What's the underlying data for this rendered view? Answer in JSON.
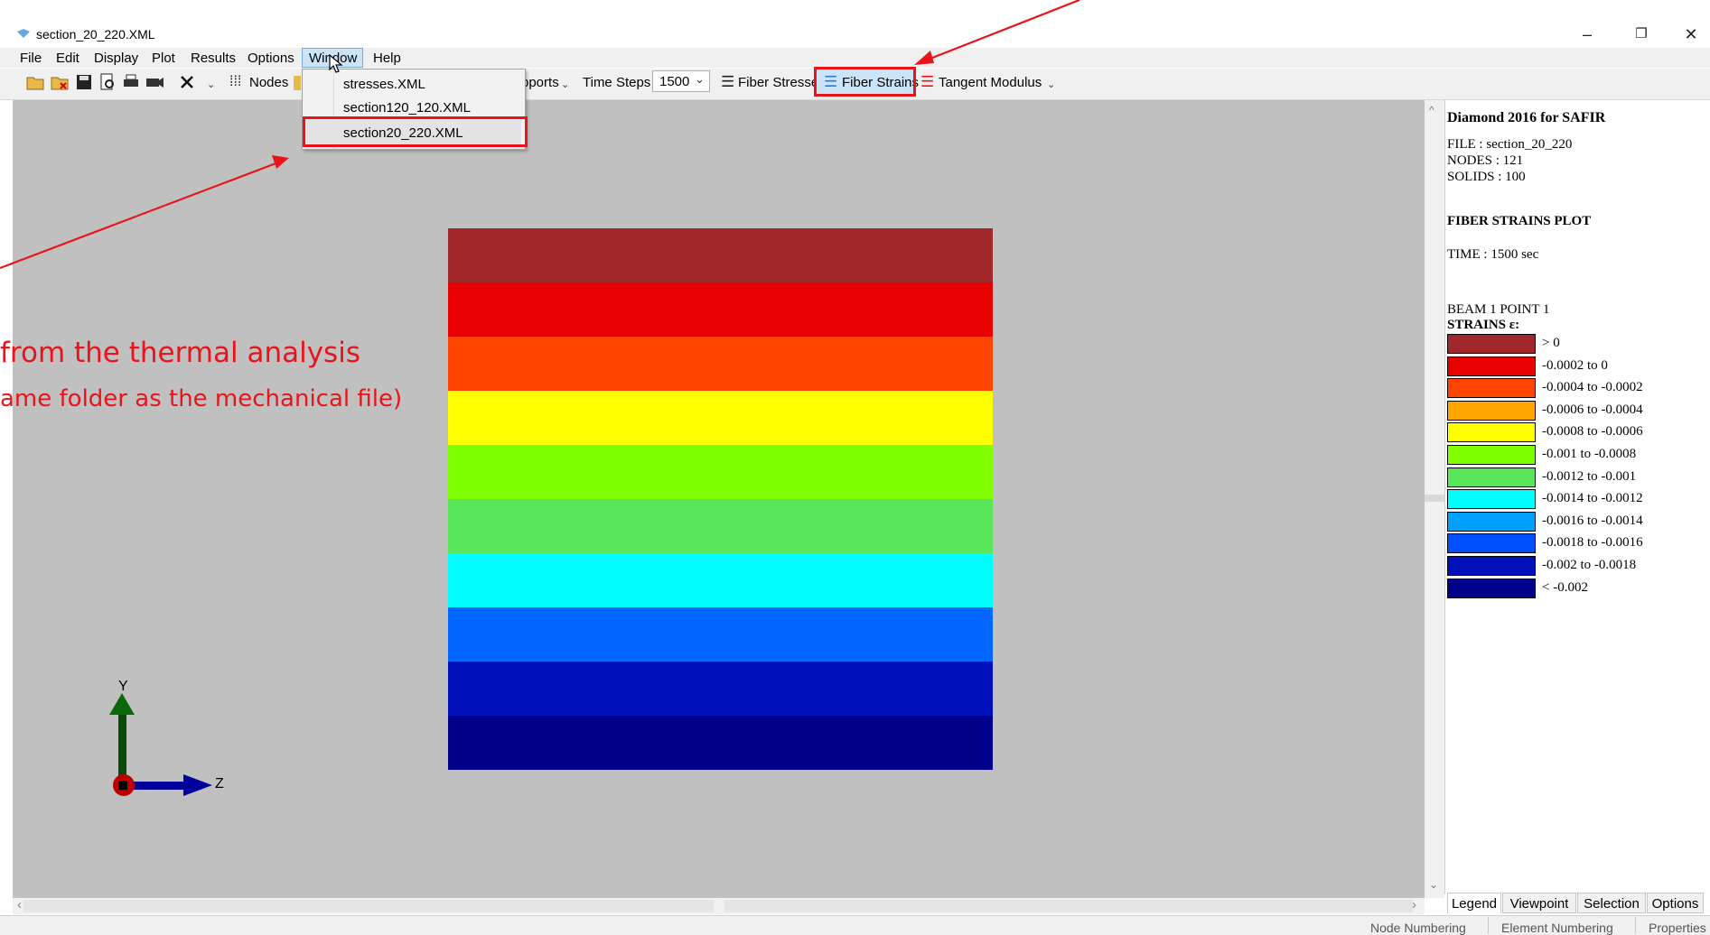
{
  "window": {
    "title": "section_20_220.XML",
    "minimize": "–",
    "restore": "❐",
    "close": "✕"
  },
  "menubar": [
    "File",
    "Edit",
    "Display",
    "Plot",
    "Results",
    "Options",
    "Window",
    "Help"
  ],
  "toolbar": {
    "nodes_label": "Nodes",
    "supports_partial": "pports",
    "time_steps_label": "Time Steps",
    "time_steps_value": "1500",
    "fiber_stresses": "Fiber Stresses",
    "fiber_strains": "Fiber Strains",
    "tangent_modulus": "Tangent Modulus"
  },
  "window_menu": {
    "items": [
      "stresses.XML",
      "section120_120.XML",
      "section20_220.XML"
    ],
    "highlighted_item": "section20_220.XML"
  },
  "annotation": {
    "line1": "from the thermal analysis",
    "line2": "ame folder as the mechanical file)",
    "color": "#e8141b"
  },
  "axes": {
    "y": "Y",
    "z": "Z"
  },
  "section_plot": {
    "band_colors": [
      "#a0282b",
      "#e60000",
      "#ff4500",
      "#ffff00",
      "#80ff00",
      "#5ae65a",
      "#00ffff",
      "#0066ff",
      "#0011bb",
      "#00008b"
    ]
  },
  "legend": {
    "title": "Diamond 2016 for SAFIR",
    "file": "FILE : section_20_220",
    "nodes": "NODES : 121",
    "solids": "SOLIDS : 100",
    "plot_title": "FIBER STRAINS PLOT",
    "time": "TIME : 1500 sec",
    "beam_point": "BEAM 1 POINT 1",
    "strains_heading": "STRAINS ε:",
    "entries": [
      {
        "color": "#a0282b",
        "label": "> 0"
      },
      {
        "color": "#e60000",
        "label": "-0.0002 to 0"
      },
      {
        "color": "#ff4500",
        "label": "-0.0004 to -0.0002"
      },
      {
        "color": "#ffa500",
        "label": "-0.0006 to -0.0004"
      },
      {
        "color": "#ffff00",
        "label": "-0.0008 to -0.0006"
      },
      {
        "color": "#80ff00",
        "label": "-0.001 to -0.0008"
      },
      {
        "color": "#5ae65a",
        "label": "-0.0012 to -0.001"
      },
      {
        "color": "#00ffff",
        "label": "-0.0014 to -0.0012"
      },
      {
        "color": "#00a0ff",
        "label": "-0.0016 to -0.0014"
      },
      {
        "color": "#0050ff",
        "label": "-0.0018 to -0.0016"
      },
      {
        "color": "#0011bb",
        "label": "-0.002 to -0.0018"
      },
      {
        "color": "#00008b",
        "label": "< -0.002"
      }
    ]
  },
  "panel_tabs": [
    "Legend",
    "Viewpoint",
    "Selection",
    "Options"
  ],
  "statusbar": [
    "Node Numbering",
    "Element Numbering",
    "Properties"
  ]
}
